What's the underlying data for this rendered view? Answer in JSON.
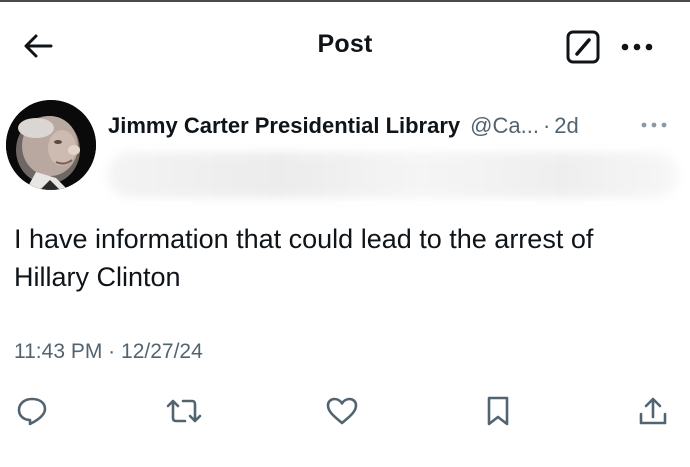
{
  "header": {
    "title": "Post",
    "back_icon": "arrow-left-icon",
    "edit_icon": "compose-icon",
    "more_icon": "more-dots-icon"
  },
  "post": {
    "author": {
      "display_name": "Jimmy Carter Presidential Library",
      "handle": "@Ca...",
      "relative_time": "2d",
      "separator": "·"
    },
    "text": "I have information that could lead to the arrest of Hillary Clinton",
    "time": "11:43 PM",
    "date": "12/27/24",
    "meta_separator": "·"
  },
  "actions": {
    "reply_icon": "reply-icon",
    "repost_icon": "repost-icon",
    "like_icon": "heart-icon",
    "bookmark_icon": "bookmark-icon",
    "share_icon": "share-icon"
  },
  "colors": {
    "text_primary": "#0f1419",
    "text_secondary": "#536471",
    "icon": "#536471"
  }
}
